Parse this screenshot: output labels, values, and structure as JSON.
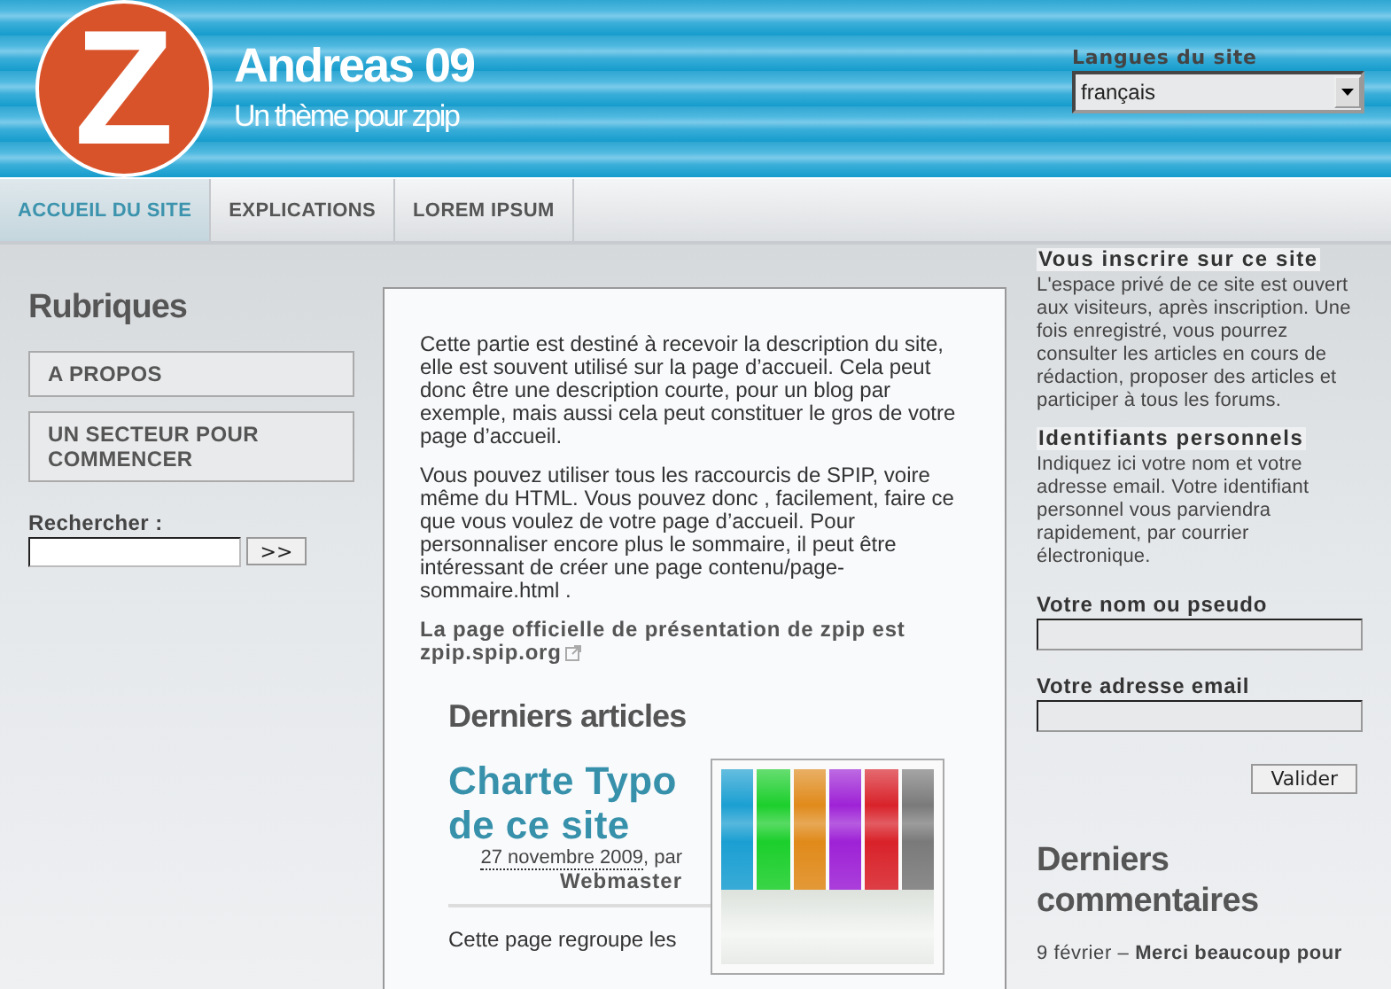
{
  "header": {
    "logo_letter": "Z",
    "title": "Andreas 09",
    "tagline": "Un thème pour zpip"
  },
  "language": {
    "label": "Langues du site",
    "value": "français"
  },
  "nav": [
    {
      "label": "ACCUEIL DU SITE",
      "selected": true
    },
    {
      "label": "EXPLICATIONS",
      "selected": false
    },
    {
      "label": "LOREM IPSUM",
      "selected": false
    }
  ],
  "sidebar": {
    "heading": "Rubriques",
    "items": [
      "A PROPOS",
      "UN SECTEUR POUR COMMENCER"
    ],
    "search": {
      "label": "Rechercher :",
      "button": ">>"
    }
  },
  "main": {
    "paragraphs": [
      "Cette partie est destiné à recevoir la description du site, elle est souvent utilisé sur la page d’accueil. Cela peut donc être une description courte, pour un blog par exemple, mais aussi cela peut constituer le gros de votre page d’accueil.",
      "Vous pouvez utiliser tous les raccourcis de SPIP, voire même du HTML. Vous pouvez donc , facilement, faire ce que vous voulez de votre page d’accueil. Pour personnaliser encore plus le sommaire, il peut être intéressant de créer une page contenu/page-sommaire.html ."
    ],
    "official": {
      "text": "La page officielle de présentation de zpip est",
      "link": "zpip.spip.org"
    },
    "articles_heading": "Derniers articles",
    "articles": [
      {
        "title": "Charte Typo de ce site",
        "date": "27 novembre 2009",
        "by": ", par",
        "author": "Webmaster",
        "excerpt": "Cette page regroupe les"
      }
    ]
  },
  "right": {
    "signup": {
      "heading": "Vous inscrire sur ce site",
      "text": "L'espace privé de ce site est ouvert aux visiteurs, après inscription. Une fois enregistré, vous pourrez consulter les articles en cours de rédaction, proposer des articles et participer à tous les forums."
    },
    "credentials": {
      "heading": "Identifiants personnels",
      "text": "Indiquez ici votre nom et votre adresse email. Votre identifiant personnel vous parviendra rapidement, par courrier électronique."
    },
    "fields": [
      {
        "label": "Votre nom ou pseudo"
      },
      {
        "label": "Votre adresse email"
      }
    ],
    "submit": "Valider",
    "comments_heading": "Derniers commentaires",
    "comments": [
      {
        "date": "9 février –",
        "text": "Merci beaucoup pour"
      }
    ]
  }
}
